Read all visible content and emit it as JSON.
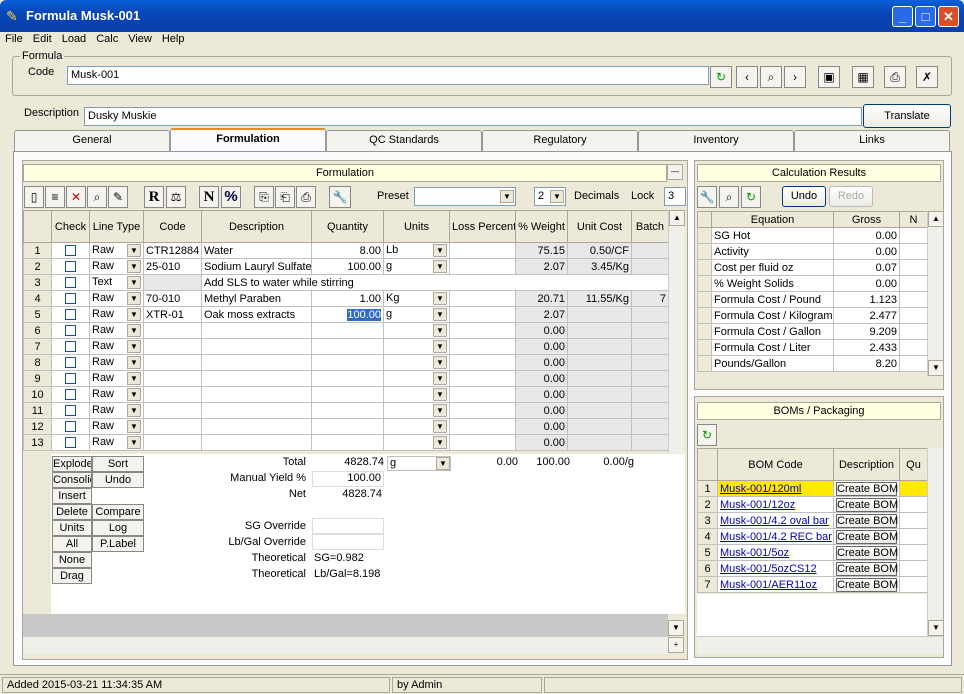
{
  "window": {
    "title": "Formula Musk-001"
  },
  "menu": [
    "File",
    "Edit",
    "Load",
    "Calc",
    "View",
    "Help"
  ],
  "formula": {
    "group_label": "Formula",
    "code_label": "Code",
    "code": "Musk-001",
    "description_label": "Description",
    "description": "Dusky Muskie",
    "translate_label": "Translate"
  },
  "tabs": [
    "General",
    "Formulation",
    "QC Standards",
    "Regulatory",
    "Inventory",
    "Links"
  ],
  "formulation": {
    "panel_title": "Formulation",
    "preset_label": "Preset",
    "preset_value": "",
    "decimals_value": "2",
    "decimals_label": "Decimals",
    "lock_label": "Lock",
    "lock_value": "3",
    "columns": [
      "Check",
      "Line Type",
      "Code",
      "Description",
      "Quantity",
      "Units",
      "Loss Percent",
      "% Weight",
      "Unit Cost",
      "Batch"
    ],
    "rows": [
      {
        "n": "1",
        "type": "Raw",
        "code": "CTR12884",
        "desc": "Water",
        "qty": "8.00",
        "units": "Lb",
        "loss": "",
        "wt": "75.15",
        "cost": "0.50/CF",
        "batch": ""
      },
      {
        "n": "2",
        "type": "Raw",
        "code": "25-010",
        "desc": "Sodium Lauryl Sulfate",
        "qty": "100.00",
        "units": "g",
        "loss": "",
        "wt": "2.07",
        "cost": "3.45/Kg",
        "batch": ""
      },
      {
        "n": "3",
        "type": "Text",
        "code": "",
        "desc": "Add SLS to water while stirring",
        "qty": "",
        "units": "",
        "loss": "",
        "wt": "",
        "cost": "",
        "batch": ""
      },
      {
        "n": "4",
        "type": "Raw",
        "code": "70-010",
        "desc": "Methyl Paraben",
        "qty": "1.00",
        "units": "Kg",
        "loss": "",
        "wt": "20.71",
        "cost": "11.55/Kg",
        "batch": "7"
      },
      {
        "n": "5",
        "type": "Raw",
        "code": "XTR-01",
        "desc": "Oak moss extracts",
        "qty": "100.00",
        "units": "g",
        "loss": "",
        "wt": "2.07",
        "cost": "",
        "batch": ""
      },
      {
        "n": "6",
        "type": "Raw",
        "code": "",
        "desc": "",
        "qty": "",
        "units": "",
        "loss": "",
        "wt": "0.00",
        "cost": "",
        "batch": ""
      },
      {
        "n": "7",
        "type": "Raw",
        "code": "",
        "desc": "",
        "qty": "",
        "units": "",
        "loss": "",
        "wt": "0.00",
        "cost": "",
        "batch": ""
      },
      {
        "n": "8",
        "type": "Raw",
        "code": "",
        "desc": "",
        "qty": "",
        "units": "",
        "loss": "",
        "wt": "0.00",
        "cost": "",
        "batch": ""
      },
      {
        "n": "9",
        "type": "Raw",
        "code": "",
        "desc": "",
        "qty": "",
        "units": "",
        "loss": "",
        "wt": "0.00",
        "cost": "",
        "batch": ""
      },
      {
        "n": "10",
        "type": "Raw",
        "code": "",
        "desc": "",
        "qty": "",
        "units": "",
        "loss": "",
        "wt": "0.00",
        "cost": "",
        "batch": ""
      },
      {
        "n": "11",
        "type": "Raw",
        "code": "",
        "desc": "",
        "qty": "",
        "units": "",
        "loss": "",
        "wt": "0.00",
        "cost": "",
        "batch": ""
      },
      {
        "n": "12",
        "type": "Raw",
        "code": "",
        "desc": "",
        "qty": "",
        "units": "",
        "loss": "",
        "wt": "0.00",
        "cost": "",
        "batch": ""
      },
      {
        "n": "13",
        "type": "Raw",
        "code": "",
        "desc": "",
        "qty": "",
        "units": "",
        "loss": "",
        "wt": "0.00",
        "cost": "",
        "batch": ""
      }
    ],
    "side_buttons": [
      [
        "Explode",
        "Sort"
      ],
      [
        "Consolidate",
        "Undo"
      ],
      [
        "Insert",
        ""
      ],
      [
        "Delete",
        "Compare"
      ],
      [
        "Units",
        "Log"
      ],
      [
        "All",
        "P.Label"
      ],
      [
        "None",
        ""
      ],
      [
        "Drag",
        ""
      ]
    ],
    "totals": {
      "total_label": "Total",
      "total": "4828.74",
      "total_units": "g",
      "loss_total": "0.00",
      "wt_total": "100.00",
      "cost_total": "0.00/g",
      "yield_label": "Manual Yield %",
      "yield": "100.00",
      "net_label": "Net",
      "net": "4828.74",
      "sg_override_label": "SG Override",
      "lbgal_override_label": "Lb/Gal Override",
      "theoretical_label": "Theoretical",
      "sg": "SG=0.982",
      "lbgal": "Lb/Gal=8.198"
    }
  },
  "calc": {
    "panel_title": "Calculation Results",
    "undo": "Undo",
    "redo": "Redo",
    "columns": [
      "Equation",
      "Gross",
      "N"
    ],
    "rows": [
      {
        "eq": "SG Hot",
        "gross": "0.00"
      },
      {
        "eq": "Activity",
        "gross": "0.00"
      },
      {
        "eq": "Cost per fluid oz",
        "gross": "0.07"
      },
      {
        "eq": "% Weight Solids",
        "gross": "0.00"
      },
      {
        "eq": "Formula Cost / Pound",
        "gross": "1.123"
      },
      {
        "eq": "Formula Cost / Kilogram",
        "gross": "2.477"
      },
      {
        "eq": "Formula Cost / Gallon",
        "gross": "9.209"
      },
      {
        "eq": "Formula Cost / Liter",
        "gross": "2.433"
      },
      {
        "eq": "Pounds/Gallon",
        "gross": "8.20"
      }
    ]
  },
  "boms": {
    "panel_title": "BOMs / Packaging",
    "columns": [
      "BOM Code",
      "Description",
      "Qu"
    ],
    "rows": [
      {
        "n": "1",
        "code": "Musk-001/120ml",
        "desc": "Create BOM"
      },
      {
        "n": "2",
        "code": "Musk-001/12oz",
        "desc": "Create BOM"
      },
      {
        "n": "3",
        "code": "Musk-001/4.2 oval bar",
        "desc": "Create BOM"
      },
      {
        "n": "4",
        "code": "Musk-001/4.2 REC bar",
        "desc": "Create BOM"
      },
      {
        "n": "5",
        "code": "Musk-001/5oz",
        "desc": "Create BOM"
      },
      {
        "n": "6",
        "code": "Musk-001/5ozCS12",
        "desc": "Create BOM"
      },
      {
        "n": "7",
        "code": "Musk-001/AER11oz",
        "desc": "Create BOM"
      }
    ]
  },
  "status": {
    "added": "Added 2015-03-21 11:34:35 AM",
    "by": "by Admin"
  }
}
